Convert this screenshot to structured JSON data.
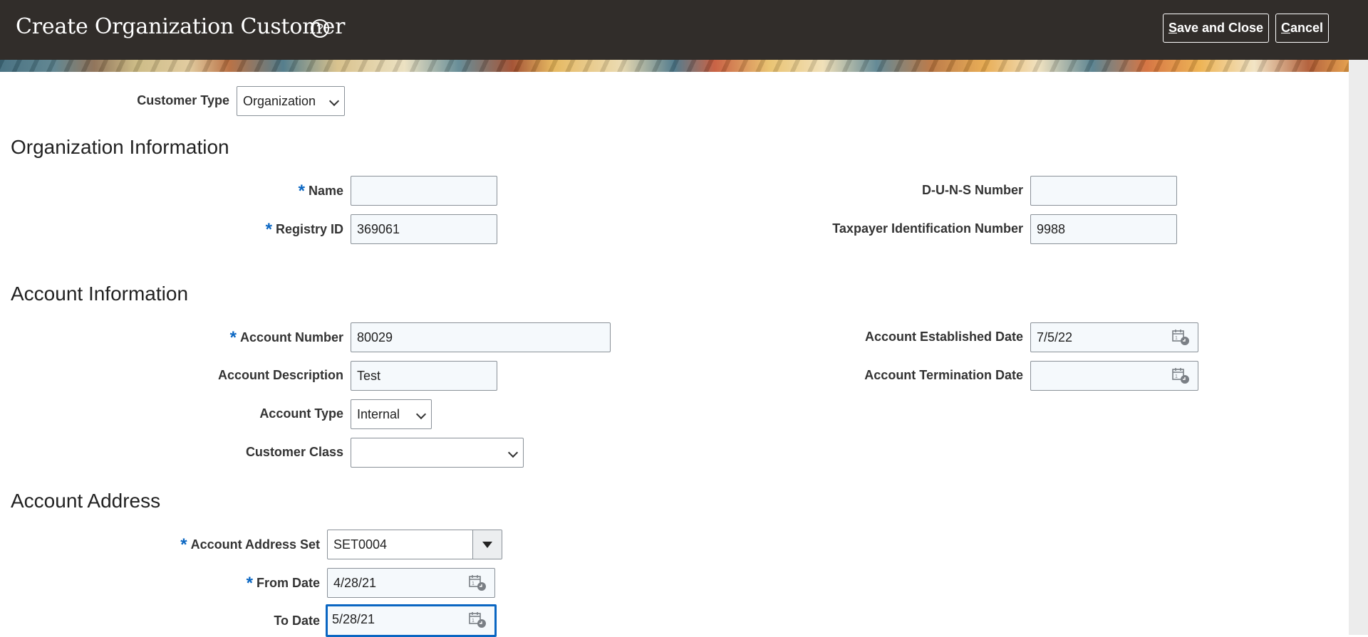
{
  "header": {
    "title": "Create Organization Customer",
    "help_icon": "question-circle-icon",
    "save_close_prefix": "S",
    "save_close_rest": "ave and Close",
    "cancel_prefix": "C",
    "cancel_rest": "ancel"
  },
  "customer_type": {
    "label": "Customer Type",
    "value": "Organization"
  },
  "organization_information": {
    "title": "Organization Information",
    "name": {
      "label": "Name",
      "required": "*",
      "value": ""
    },
    "registry_id": {
      "label": "Registry ID",
      "required": "*",
      "value": "369061"
    },
    "duns_number": {
      "label": "D-U-N-S Number",
      "value": ""
    },
    "taxpayer_id": {
      "label": "Taxpayer Identification Number",
      "value": "9988"
    }
  },
  "account_information": {
    "title": "Account Information",
    "account_number": {
      "label": "Account Number",
      "required": "*",
      "value": "80029"
    },
    "account_description": {
      "label": "Account Description",
      "value": "Test"
    },
    "account_type": {
      "label": "Account Type",
      "value": "Internal"
    },
    "customer_class": {
      "label": "Customer Class",
      "value": ""
    },
    "established_date": {
      "label": "Account Established Date",
      "value": "7/5/22"
    },
    "termination_date": {
      "label": "Account Termination Date",
      "value": ""
    }
  },
  "account_address": {
    "title": "Account Address",
    "address_set": {
      "label": "Account Address Set",
      "required": "*",
      "value": "SET0004"
    },
    "from_date": {
      "label": "From Date",
      "required": "*",
      "value": "4/28/21"
    },
    "to_date": {
      "label": "To Date",
      "value": "5/28/21"
    }
  },
  "icons": {
    "calendar": "calendar-icon",
    "chevron": "chevron-down-icon",
    "dropdown": "dropdown-arrow-icon"
  },
  "colors": {
    "header_bg": "#312d2a",
    "required_marker": "#0a66c2",
    "focus_ring": "#0a66c2",
    "field_bg": "#f5f9fc"
  }
}
